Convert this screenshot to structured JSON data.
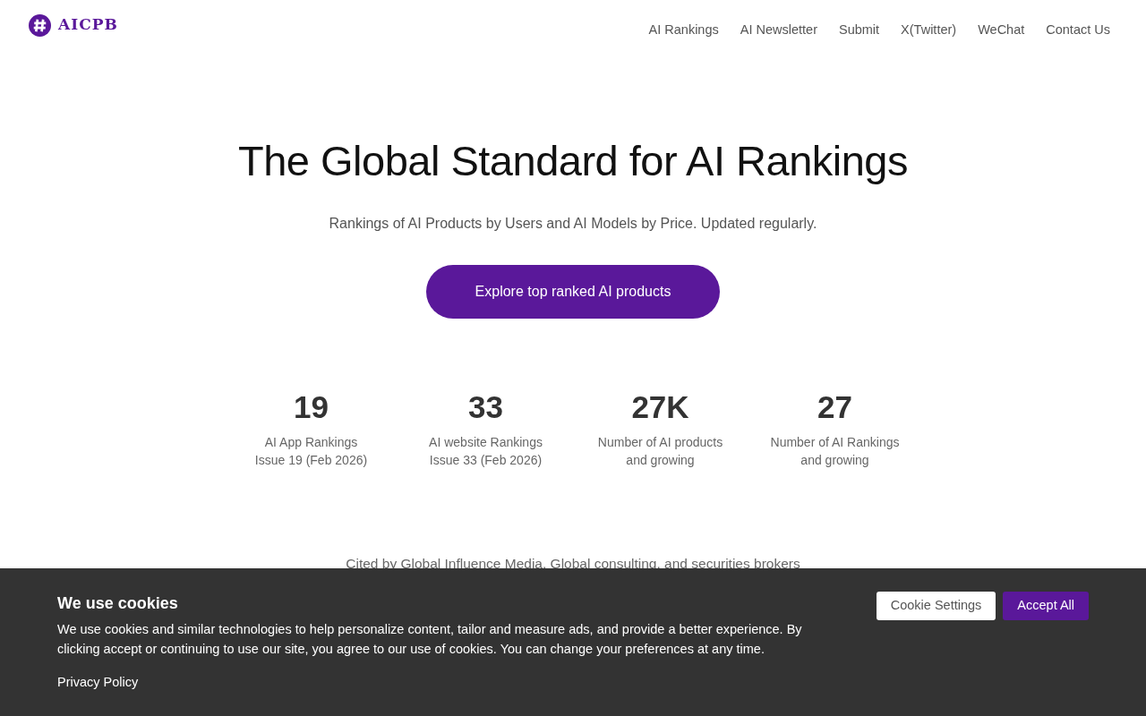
{
  "brand": {
    "name": "AICPB"
  },
  "nav": [
    {
      "label": "AI Rankings"
    },
    {
      "label": "AI Newsletter"
    },
    {
      "label": "Submit"
    },
    {
      "label": "X(Twitter)"
    },
    {
      "label": "WeChat"
    },
    {
      "label": "Contact Us"
    }
  ],
  "hero": {
    "title": "The Global Standard for AI Rankings",
    "subtitle": "Rankings of AI Products by Users and AI Models by Price. Updated regularly.",
    "button": "Explore top ranked AI products"
  },
  "stats": [
    {
      "value": "19",
      "line_1": "AI App Rankings",
      "line_2": "Issue 19 (Feb 2026)"
    },
    {
      "value": "33",
      "line_1": "AI website Rankings",
      "line_2": "Issue 33 (Feb 2026)"
    },
    {
      "value": "27K",
      "line_1": "Number of AI products",
      "line_2": "and growing"
    },
    {
      "value": "27",
      "line_1": "Number of AI Rankings",
      "line_2": "and growing"
    }
  ],
  "cited": {
    "caption": "Cited by Global Influence Media, Global consulting, and securities brokers"
  },
  "cookie_banner": {
    "title": "We use cookies",
    "body": "We use cookies and similar technologies to help personalize content, tailor and measure ads, and provide a better experience. By clicking accept or continuing to use our site, you agree to our use of cookies. You can change your preferences at any time.",
    "link": "Privacy Policy",
    "buttons": [
      {
        "label": "Cookie Settings",
        "kind": "secondary"
      },
      {
        "label": "Accept All",
        "kind": "primary"
      }
    ]
  }
}
